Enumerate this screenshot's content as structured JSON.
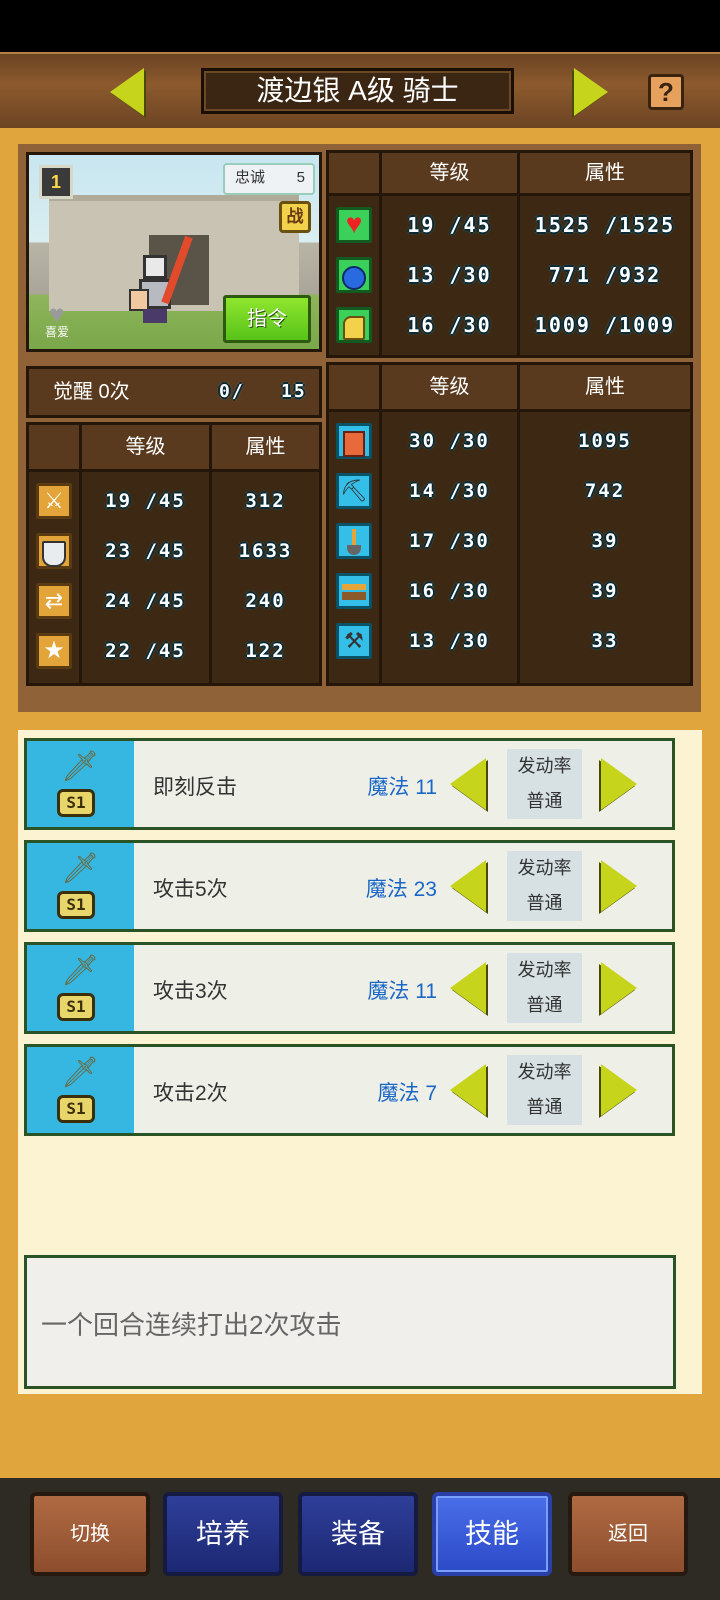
{
  "header": {
    "title": "渡边银 A级 骑士",
    "help": "?"
  },
  "portrait": {
    "loyalty_label": "忠诚",
    "loyalty_value": "5",
    "battle_label": "战",
    "command_label": "指令",
    "like_label": "喜爱",
    "rank": "1"
  },
  "vitals": {
    "col_level": "等级",
    "col_attr": "属性",
    "rows": [
      {
        "icon": "heart-icon",
        "level": "19 /45",
        "attr": "1525 /1525"
      },
      {
        "icon": "mana-potion-icon",
        "level": "13 /30",
        "attr": "771 /932"
      },
      {
        "icon": "strength-arm-icon",
        "level": "16 /30",
        "attr": "1009 /1009"
      }
    ]
  },
  "awaken": {
    "label": "觉醒 0次",
    "progress": "0/",
    "max": "15"
  },
  "combat": {
    "col_level": "等级",
    "col_attr": "属性",
    "rows": [
      {
        "icon": "sword-icon",
        "level": "19 /45",
        "attr": "312"
      },
      {
        "icon": "shield-icon",
        "level": "23 /45",
        "attr": "1633"
      },
      {
        "icon": "speed-arrows-icon",
        "level": "24 /45",
        "attr": "240"
      },
      {
        "icon": "star-icon",
        "level": "22 /45",
        "attr": "122"
      }
    ]
  },
  "work": {
    "col_level": "等级",
    "col_attr": "属性",
    "rows": [
      {
        "icon": "book-icon",
        "level": "30 /30",
        "attr": "1095"
      },
      {
        "icon": "pickaxe-icon",
        "level": "14 /30",
        "attr": "742"
      },
      {
        "icon": "shovel-icon",
        "level": "17 /30",
        "attr": "39"
      },
      {
        "icon": "bed-icon",
        "level": "16 /30",
        "attr": "39"
      },
      {
        "icon": "hammer-icon",
        "level": "13 /30",
        "attr": "33"
      }
    ]
  },
  "skills": [
    {
      "badge": "S1",
      "name": "即刻反击",
      "magic": "魔法 11",
      "rate_label": "发动率",
      "rate_value": "普通"
    },
    {
      "badge": "S1",
      "name": "攻击5次",
      "magic": "魔法 23",
      "rate_label": "发动率",
      "rate_value": "普通"
    },
    {
      "badge": "S1",
      "name": "攻击3次",
      "magic": "魔法 11",
      "rate_label": "发动率",
      "rate_value": "普通"
    },
    {
      "badge": "S1",
      "name": "攻击2次",
      "magic": "魔法 7",
      "rate_label": "发动率",
      "rate_value": "普通"
    }
  ],
  "description": "一个回合连续打出2次攻击",
  "nav": {
    "switch": "切换",
    "train": "培养",
    "equip": "装备",
    "skill": "技能",
    "back": "返回"
  },
  "colors": {
    "accent_orange": "#e0a53c",
    "skill_blue": "#35b7e2",
    "magic_text": "#1b67c7",
    "arrow_yellow": "#c7d41c",
    "active_tab": "#4a6ee8"
  }
}
